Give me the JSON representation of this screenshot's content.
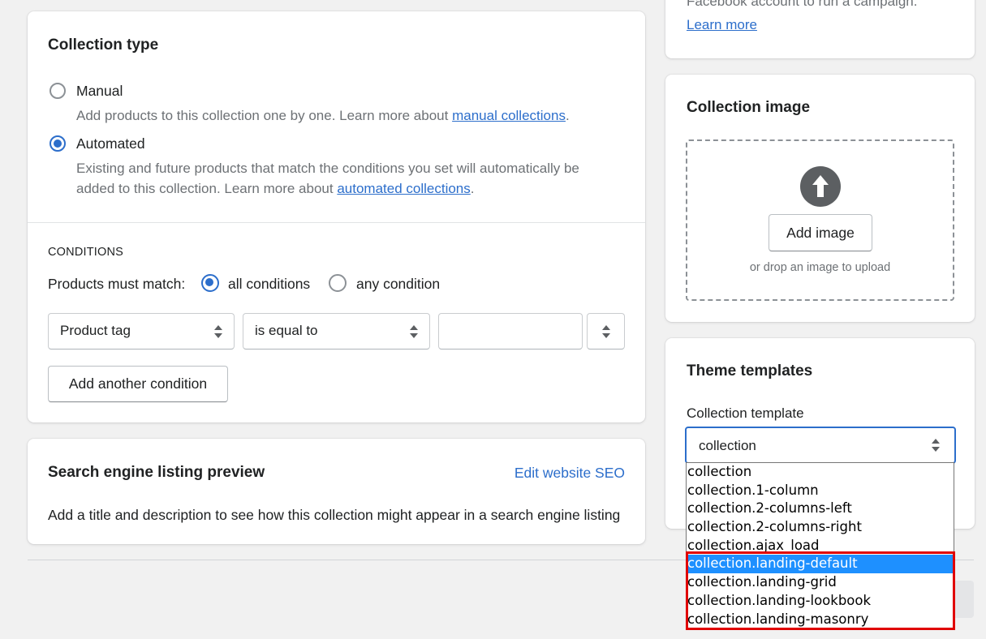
{
  "collection_type": {
    "title": "Collection type",
    "manual_label": "Manual",
    "manual_desc": "Add products to this collection one by one. Learn more about",
    "manual_link": "manual collections",
    "automated_label": "Automated",
    "automated_desc_line1": "Existing and future products that match the conditions you set will automatically be",
    "automated_desc_line2": "added to this collection. Learn more about",
    "automated_link": "automated collections",
    "period": "."
  },
  "conditions": {
    "heading": "CONDITIONS",
    "must_match_label": "Products must match:",
    "all_label": "all conditions",
    "any_label": "any condition",
    "field_value": "Product tag",
    "operator_value": "is equal to",
    "text_value": "",
    "add_button": "Add another condition"
  },
  "seo": {
    "title": "Search engine listing preview",
    "edit_link": "Edit website SEO",
    "description": "Add a title and description to see how this collection might appear in a search engine listing"
  },
  "facebook": {
    "partial_text": "Facebook account to run a campaign.",
    "learn_more": "Learn more"
  },
  "collection_image": {
    "title": "Collection image",
    "add_button": "Add image",
    "hint": "or drop an image to upload",
    "upload_icon": "arrow-up-circle-icon"
  },
  "theme_templates": {
    "title": "Theme templates",
    "template_label": "Collection template",
    "selected": "collection",
    "options": [
      "collection",
      "collection.1-column",
      "collection.2-columns-left",
      "collection.2-columns-right",
      "collection.ajax_load",
      "collection.landing-default",
      "collection.landing-grid",
      "collection.landing-lookbook",
      "collection.landing-masonry"
    ],
    "highlighted_option": "collection.landing-default"
  },
  "colors": {
    "accent": "#2c6ecb",
    "highlight_box": "#e00000",
    "selected_option_bg": "#1e90ff"
  }
}
